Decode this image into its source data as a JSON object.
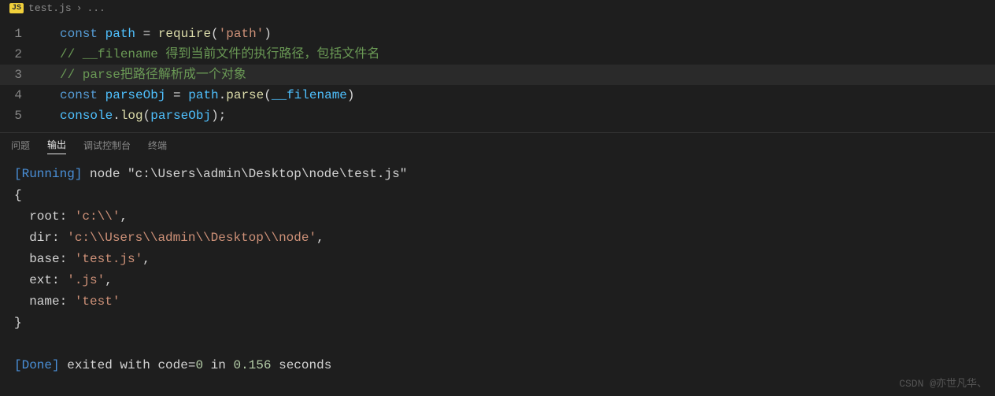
{
  "breadcrumb": {
    "icon_label": "JS",
    "file": "test.js",
    "sep": "›",
    "after": "..."
  },
  "editor": {
    "lines": [
      {
        "num": "1",
        "focused": false,
        "tokens": [
          {
            "t": "const ",
            "c": "kw"
          },
          {
            "t": "path",
            "c": "const"
          },
          {
            "t": " = ",
            "c": "punct"
          },
          {
            "t": "require",
            "c": "func"
          },
          {
            "t": "(",
            "c": "punct"
          },
          {
            "t": "'path'",
            "c": "str"
          },
          {
            "t": ")",
            "c": "punct"
          }
        ]
      },
      {
        "num": "2",
        "focused": false,
        "tokens": [
          {
            "t": "// __filename 得到当前文件的执行路径，包括文件名",
            "c": "comment"
          }
        ]
      },
      {
        "num": "3",
        "focused": true,
        "tokens": [
          {
            "t": "// parse把路径解析成一个对象",
            "c": "comment"
          }
        ]
      },
      {
        "num": "4",
        "focused": false,
        "tokens": [
          {
            "t": "const ",
            "c": "kw"
          },
          {
            "t": "parseObj",
            "c": "const"
          },
          {
            "t": " = ",
            "c": "punct"
          },
          {
            "t": "path",
            "c": "var"
          },
          {
            "t": ".",
            "c": "punct"
          },
          {
            "t": "parse",
            "c": "func"
          },
          {
            "t": "(",
            "c": "punct"
          },
          {
            "t": "__filename",
            "c": "var"
          },
          {
            "t": ")",
            "c": "punct"
          }
        ]
      },
      {
        "num": "5",
        "focused": false,
        "tokens": [
          {
            "t": "console",
            "c": "var"
          },
          {
            "t": ".",
            "c": "punct"
          },
          {
            "t": "log",
            "c": "func"
          },
          {
            "t": "(",
            "c": "punct"
          },
          {
            "t": "parseObj",
            "c": "var"
          },
          {
            "t": ");",
            "c": "punct"
          }
        ]
      }
    ]
  },
  "panel": {
    "tabs": {
      "problems": "问题",
      "output": "输出",
      "debug": "调试控制台",
      "terminal": "终端"
    },
    "output": {
      "running_prefix": "[Running]",
      "running_cmd": " node \"c:\\Users\\admin\\Desktop\\node\\test.js\"",
      "obj_open": "{",
      "obj_lines": [
        "  root: 'c:\\\\',",
        "  dir: 'c:\\\\Users\\\\admin\\\\Desktop\\\\node',",
        "  base: 'test.js',",
        "  ext: '.js',",
        "  name: 'test'"
      ],
      "obj_close": "}",
      "done_prefix": "[Done]",
      "done_text1": " exited with ",
      "done_code_label": "code",
      "done_eq": "=",
      "done_code": "0",
      "done_text2": " in ",
      "done_secs": "0.156",
      "done_text3": " seconds"
    }
  },
  "watermark": "CSDN @亦世凡华、"
}
